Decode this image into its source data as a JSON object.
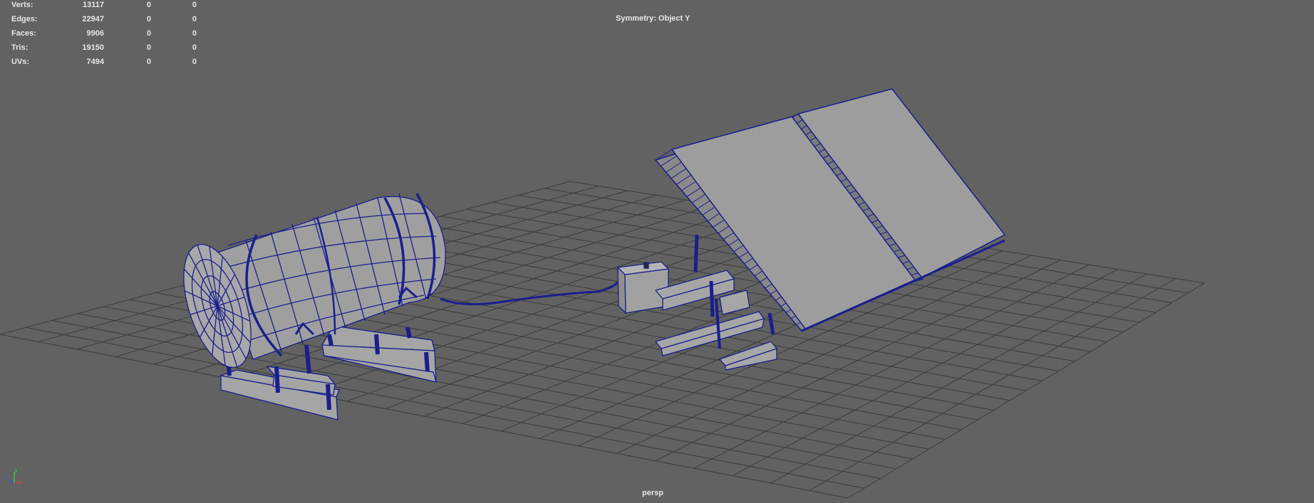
{
  "hud": {
    "rows": [
      {
        "label": "Verts:",
        "total": "13117",
        "selected": "0",
        "components": "0"
      },
      {
        "label": "Edges:",
        "total": "22947",
        "selected": "0",
        "components": "0"
      },
      {
        "label": "Faces:",
        "total": "9906",
        "selected": "0",
        "components": "0"
      },
      {
        "label": "Tris:",
        "total": "19150",
        "selected": "0",
        "components": "0"
      },
      {
        "label": "UVs:",
        "total": "7494",
        "selected": "0",
        "components": "0"
      }
    ]
  },
  "symmetry_label": "Symmetry: Object Y",
  "camera_label": "persp",
  "axis": {
    "y": "y",
    "x": "x",
    "z": "z"
  },
  "colors": {
    "viewport_bg": "#626262",
    "grid": "#3c3c3c",
    "wire": "#1a1f8c",
    "surface": "#a9a9a9"
  }
}
